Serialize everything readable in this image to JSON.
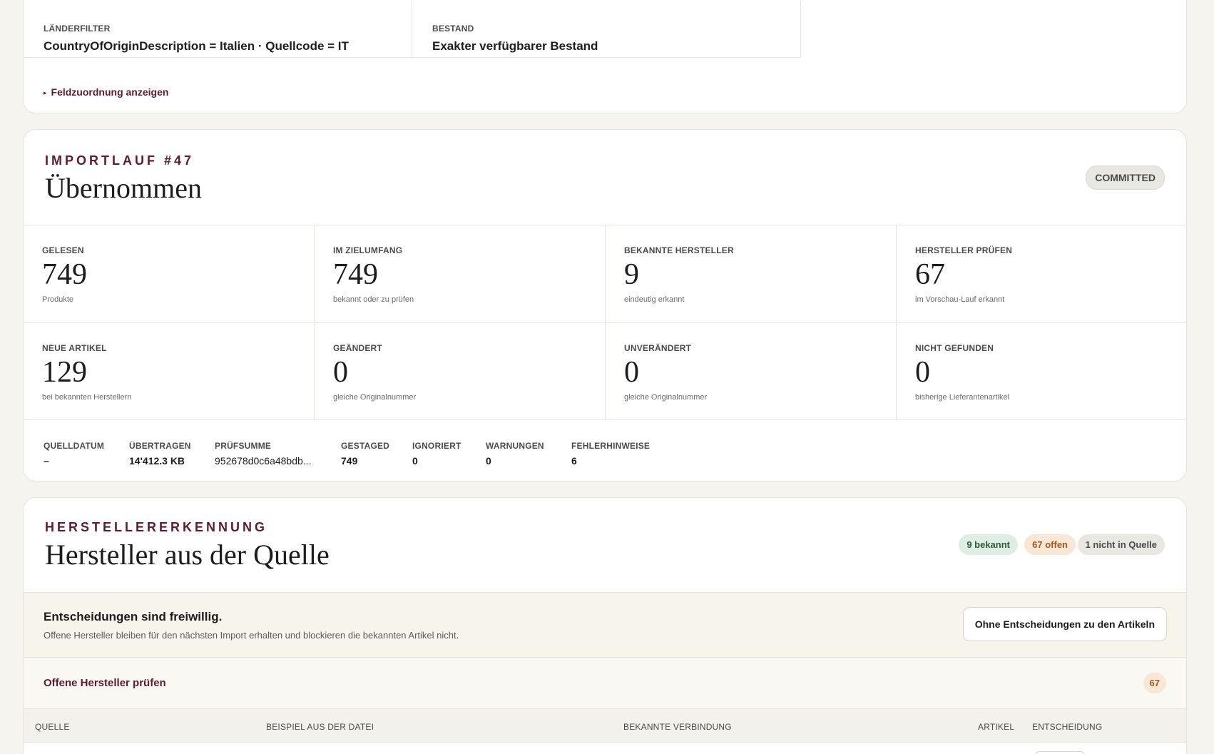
{
  "filters": {
    "country": {
      "label": "LÄNDERFILTER",
      "value": "CountryOfOriginDescription = Italien · Quellcode = IT"
    },
    "stock": {
      "label": "BESTAND",
      "value": "Exakter verfügbarer Bestand"
    },
    "mapping_toggle": "Feldzuordnung anzeigen",
    "toggle_icon": "▸"
  },
  "import_run": {
    "eyebrow": "IMPORTLAUF #47",
    "title": "Übernommen",
    "status": "COMMITTED",
    "metrics": [
      {
        "label": "GELESEN",
        "value": "749",
        "sub": "Produkte"
      },
      {
        "label": "IM ZIELUMFANG",
        "value": "749",
        "sub": "bekannt oder zu prüfen"
      },
      {
        "label": "BEKANNTE HERSTELLER",
        "value": "9",
        "sub": "eindeutig erkannt"
      },
      {
        "label": "HERSTELLER PRÜFEN",
        "value": "67",
        "sub": "im Vorschau-Lauf erkannt"
      },
      {
        "label": "NEUE ARTIKEL",
        "value": "129",
        "sub": "bei bekannten Herstellern"
      },
      {
        "label": "GEÄNDERT",
        "value": "0",
        "sub": "gleiche Originalnummer"
      },
      {
        "label": "UNVERÄNDERT",
        "value": "0",
        "sub": "gleiche Originalnummer"
      },
      {
        "label": "NICHT GEFUNDEN",
        "value": "0",
        "sub": "bisherige Lieferantenartikel"
      }
    ],
    "meta": [
      {
        "label": "QUELLDATUM",
        "value": "–"
      },
      {
        "label": "ÜBERTRAGEN",
        "value": "14'412.3 KB"
      },
      {
        "label": "PRÜFSUMME",
        "value": "952678d0c6a48bdb..."
      },
      {
        "label": "GESTAGED",
        "value": "749"
      },
      {
        "label": "IGNORIERT",
        "value": "0"
      },
      {
        "label": "WARNUNGEN",
        "value": "0"
      },
      {
        "label": "FEHLERHINWEISE",
        "value": "6"
      }
    ]
  },
  "manufacturers": {
    "eyebrow": "HERSTELLERERKENNUNG",
    "title": "Hersteller aus der Quelle",
    "pills": {
      "known": "9 bekannt",
      "open": "67 offen",
      "missing": "1 nicht in Quelle"
    },
    "notice": {
      "title": "Entscheidungen sind freiwillig.",
      "text": "Offene Hersteller bleiben für den nächsten Import erhalten und blockieren die bekannten Artikel nicht.",
      "button": "Ohne Entscheidungen zu den Artikeln"
    },
    "open_section": {
      "label": "Offene Hersteller prüfen",
      "count": "67"
    },
    "table_headers": {
      "source": "QUELLE",
      "example": "BEISPIEL AUS DER DATEI",
      "known_link": "BEKANNTE VERBINDUNG",
      "articles": "ARTIKEL",
      "decision": "ENTSCHEIDUNG"
    }
  },
  "colors": {
    "accent": "#5e1a33",
    "known_bg": "#dfeee4",
    "open_bg": "#f9e7d6",
    "neutral_bg": "#e9e7e2"
  }
}
